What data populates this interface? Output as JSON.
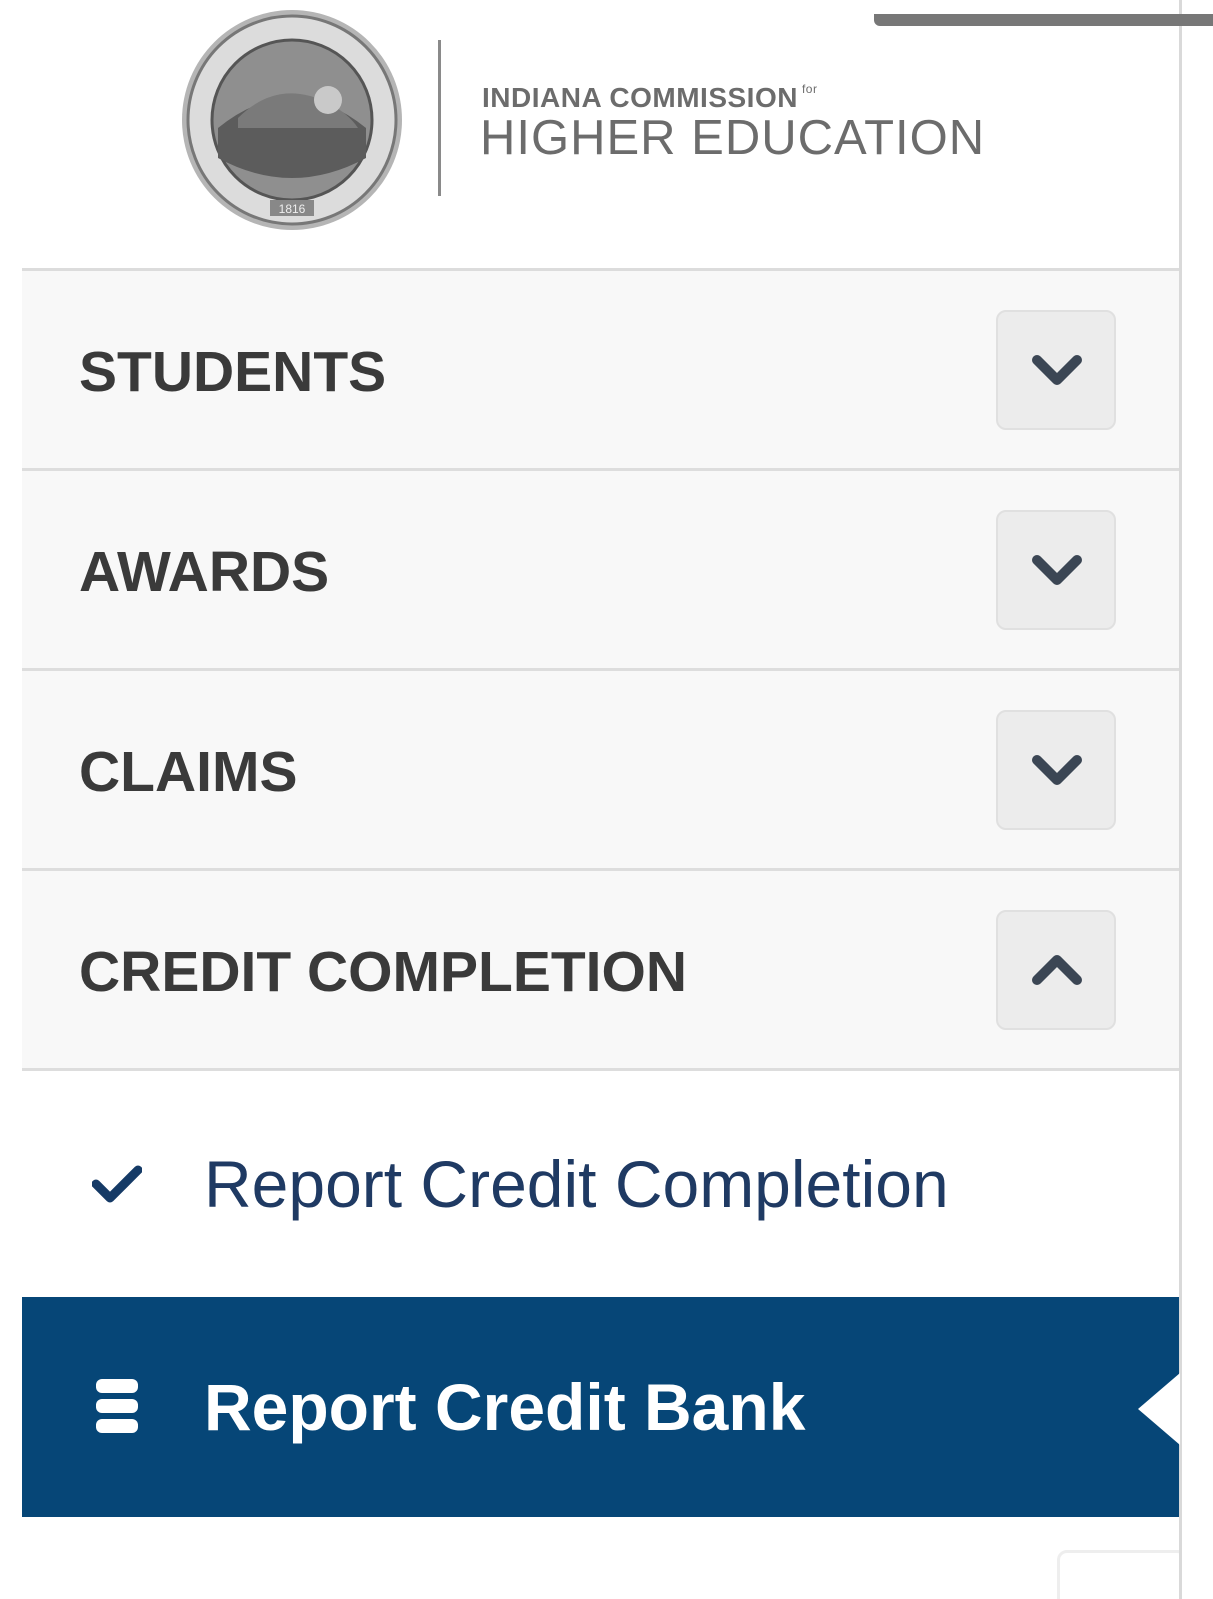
{
  "header": {
    "org_line1": "INDIANA COMMISSION",
    "org_line1_suffix": "for",
    "org_line2": "HIGHER EDUCATION",
    "seal_year": "1816"
  },
  "nav": {
    "sections": [
      {
        "label": "STUDENTS",
        "expanded": false
      },
      {
        "label": "AWARDS",
        "expanded": false
      },
      {
        "label": "CLAIMS",
        "expanded": false
      },
      {
        "label": "CREDIT COMPLETION",
        "expanded": true
      }
    ],
    "submenu": [
      {
        "label": "Report Credit Completion",
        "icon": "check-icon",
        "active": false
      },
      {
        "label": "Report Credit Bank",
        "icon": "database-icon",
        "active": true
      }
    ]
  },
  "colors": {
    "active_bg": "#064677",
    "section_bg": "#f8f8f8",
    "text_dark": "#3a3a3a",
    "link_text": "#1f3a63"
  }
}
